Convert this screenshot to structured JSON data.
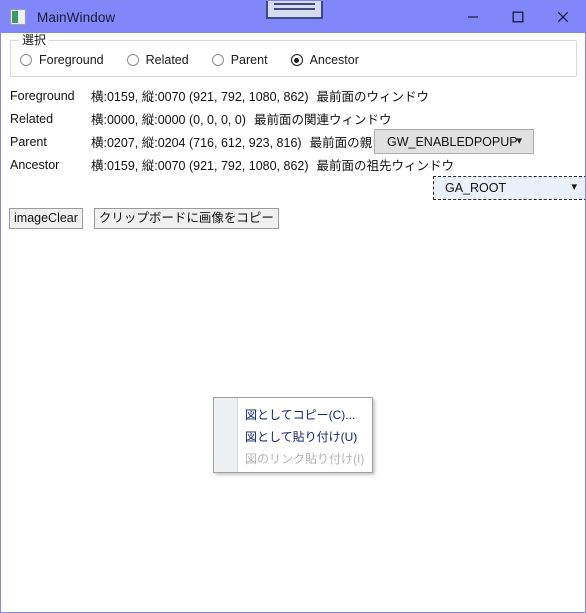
{
  "window": {
    "title": "MainWindow",
    "app_icon": "window-app-icon",
    "accent_color": "#8186f8",
    "border_color": "#8186f0",
    "buttons": [
      {
        "name": "minimize",
        "glyph": "minimize-icon"
      },
      {
        "name": "maximize",
        "glyph": "maximize-icon"
      },
      {
        "name": "close",
        "glyph": "close-icon"
      }
    ]
  },
  "caption_widget": {
    "name": "caption-strip-widget"
  },
  "groupbox": {
    "title": "選択",
    "radios": [
      {
        "label": "Foreground",
        "checked": false
      },
      {
        "label": "Related",
        "checked": false
      },
      {
        "label": "Parent",
        "checked": false
      },
      {
        "label": "Ancestor",
        "checked": true
      }
    ]
  },
  "rows": [
    {
      "label": "Foreground",
      "metrics": "横:0159, 縦:0070  (921, 792, 1080, 862)",
      "desc": "最前面のウィンドウ"
    },
    {
      "label": "Related",
      "metrics": "横:0000, 縦:0000  (0, 0, 0, 0)",
      "desc": "最前面の関連ウィンドウ"
    },
    {
      "label": "Parent",
      "metrics": "横:0207, 縦:0204  (716, 612, 923, 816)",
      "desc": "最前面の親ウィンドウ"
    },
    {
      "label": "Ancestor",
      "metrics": "横:0159, 縦:0070  (921, 792, 1080, 862)",
      "desc": "最前面の祖先ウィンドウ"
    }
  ],
  "combo_related": {
    "value": "GW_ENABLEDPOPUP",
    "arrow": "chevron-down-icon"
  },
  "combo_ancestor": {
    "value": "GA_ROOT",
    "arrow": "chevron-down-icon"
  },
  "buttons": {
    "image_clear": "imageClear",
    "copy_to_clipboard": "クリップボードに画像をコピー"
  },
  "context_menu": {
    "items": [
      {
        "label": "図としてコピー(C)...",
        "disabled": false
      },
      {
        "label": "図として貼り付け(U)",
        "disabled": false
      },
      {
        "label": "図のリンク貼り付け(I)",
        "disabled": true
      }
    ]
  }
}
